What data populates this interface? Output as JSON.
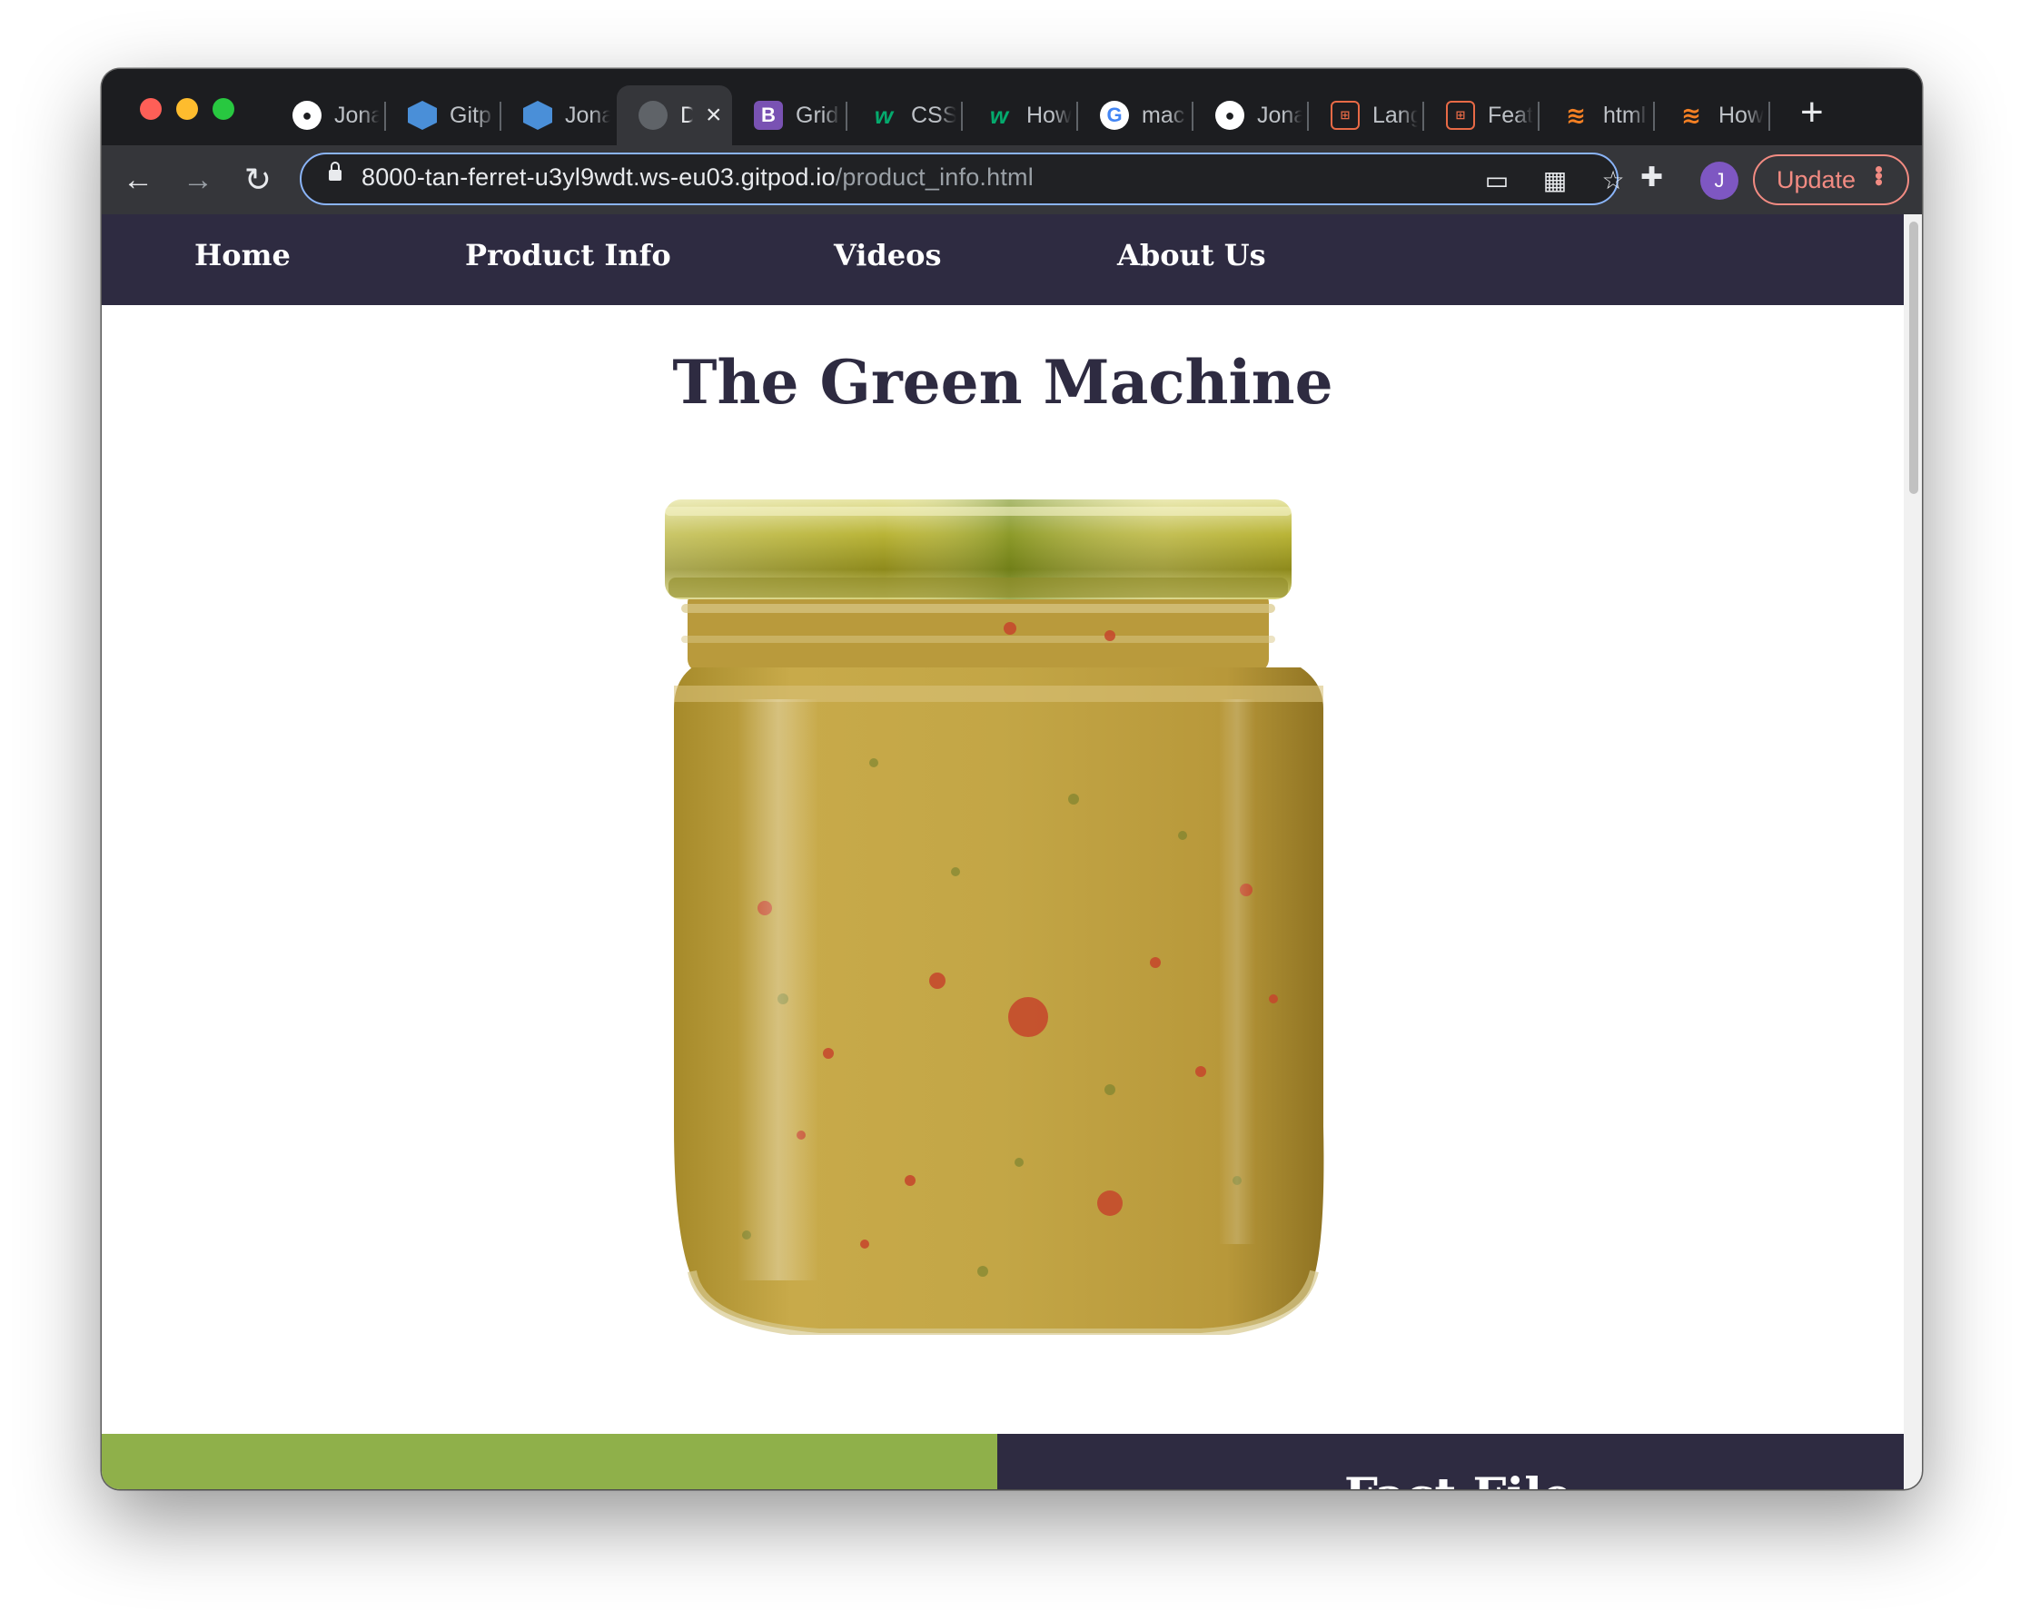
{
  "browser": {
    "tabs": [
      {
        "favicon": "github-icon",
        "title": "Jona"
      },
      {
        "favicon": "gitpod-icon",
        "title": "Gitp"
      },
      {
        "favicon": "gitpod-icon",
        "title": "Jona"
      },
      {
        "favicon": "globe-icon",
        "title": "D",
        "active": true
      },
      {
        "favicon": "bootstrap-icon",
        "title": "Grid"
      },
      {
        "favicon": "w3schools-icon",
        "title": "CSS"
      },
      {
        "favicon": "w3schools-icon",
        "title": "How"
      },
      {
        "favicon": "google-icon",
        "title": "mac"
      },
      {
        "favicon": "github-icon",
        "title": "Jona"
      },
      {
        "favicon": "caniuse-icon",
        "title": "Lang"
      },
      {
        "favicon": "caniuse-icon",
        "title": "Feat"
      },
      {
        "favicon": "stackoverflow-icon",
        "title": "html"
      },
      {
        "favicon": "stackoverflow-icon",
        "title": "How"
      }
    ],
    "url_host": "8000-tan-ferret-u3yl9wdt.ws-eu03.gitpod.io",
    "url_path": "/product_info.html",
    "avatar_letter": "J",
    "update_label": "Update"
  },
  "site": {
    "nav": [
      "Home",
      "Product Info",
      "Videos",
      "About Us"
    ],
    "title": "The Green Machine",
    "section_heading_partial": "Fact File"
  },
  "colors": {
    "nav_bg": "#2e2b41",
    "accent_green": "#8fb04a",
    "title_text": "#2e2b41"
  }
}
